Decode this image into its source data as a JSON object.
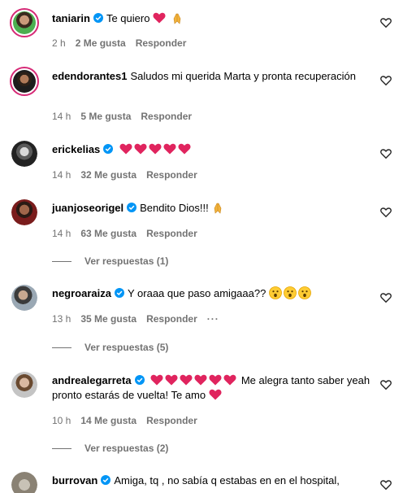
{
  "comments": [
    {
      "user": "taniarin",
      "text": "Te quiero",
      "time": "2 h",
      "likes": "2 Me gusta",
      "reply": "Responder"
    },
    {
      "user": "edendorantes1",
      "text": "Saludos mi querida Marta y pronta recuperación",
      "time": "14 h",
      "likes": "5 Me gusta",
      "reply": "Responder"
    },
    {
      "user": "erickelias",
      "text": "",
      "time": "14 h",
      "likes": "32 Me gusta",
      "reply": "Responder"
    },
    {
      "user": "juanjoseorigel",
      "text": "Bendito Dios!!!",
      "time": "14 h",
      "likes": "63 Me gusta",
      "reply": "Responder",
      "view_replies": "Ver respuestas (1)"
    },
    {
      "user": "negroaraiza",
      "text": "Y oraaa que paso amigaaa??",
      "time": "13 h",
      "likes": "35 Me gusta",
      "reply": "Responder",
      "view_replies": "Ver respuestas (5)"
    },
    {
      "user": "andrealegarreta",
      "text_after": "Me alegra tanto saber yeah pronto estarás de vuelta! Te amo",
      "time": "10 h",
      "likes": "14 Me gusta",
      "reply": "Responder",
      "view_replies": "Ver respuestas (2)"
    },
    {
      "user": "burrovan",
      "text": "Amiga, tq , no sabía q estabas en en el hospital,"
    }
  ],
  "icons": {
    "like": "heart-outline-icon",
    "verified": "verified-badge-icon",
    "more": "more-options-icon"
  },
  "colors": {
    "verified": "#0095f6",
    "heart": "#e0245e",
    "meta": "#737373"
  }
}
